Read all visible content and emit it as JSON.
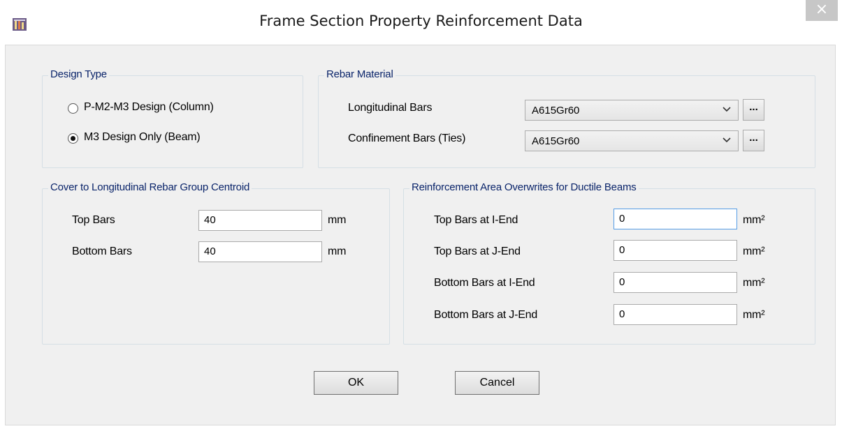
{
  "window": {
    "title": "Frame Section Property Reinforcement Data",
    "close_glyph": "×"
  },
  "design_type": {
    "title": "Design Type",
    "options": [
      {
        "label": "P-M2-M3 Design  (Column)",
        "checked": false
      },
      {
        "label": "M3 Design Only  (Beam)",
        "checked": true
      }
    ]
  },
  "rebar_material": {
    "title": "Rebar Material",
    "longitudinal": {
      "label": "Longitudinal Bars",
      "value": "A615Gr60"
    },
    "confinement": {
      "label": "Confinement Bars (Ties)",
      "value": "A615Gr60"
    },
    "browse_label": "..."
  },
  "cover": {
    "title": "Cover to Longitudinal Rebar Group Centroid",
    "top": {
      "label": "Top Bars",
      "value": "40",
      "unit": "mm"
    },
    "bottom": {
      "label": "Bottom  Bars",
      "value": "40",
      "unit": "mm"
    }
  },
  "overwrites": {
    "title": "Reinforcement Area Overwrites for Ductile Beams",
    "rows": [
      {
        "label": "Top Bars at I-End",
        "value": "0",
        "unit": "mm²"
      },
      {
        "label": "Top Bars at J-End",
        "value": "0",
        "unit": "mm²"
      },
      {
        "label": "Bottom Bars at I-End",
        "value": "0",
        "unit": "mm²"
      },
      {
        "label": "Bottom Bars at J-End",
        "value": "0",
        "unit": "mm²"
      }
    ]
  },
  "buttons": {
    "ok": "OK",
    "cancel": "Cancel"
  },
  "colors": {
    "group_title": "#0a246a",
    "close_button": "#c7c7c7",
    "focus_border": "#569de5"
  },
  "icons": {
    "app": "app-logo-icon",
    "close": "close-icon",
    "dropdown": "chevron-down-icon"
  }
}
